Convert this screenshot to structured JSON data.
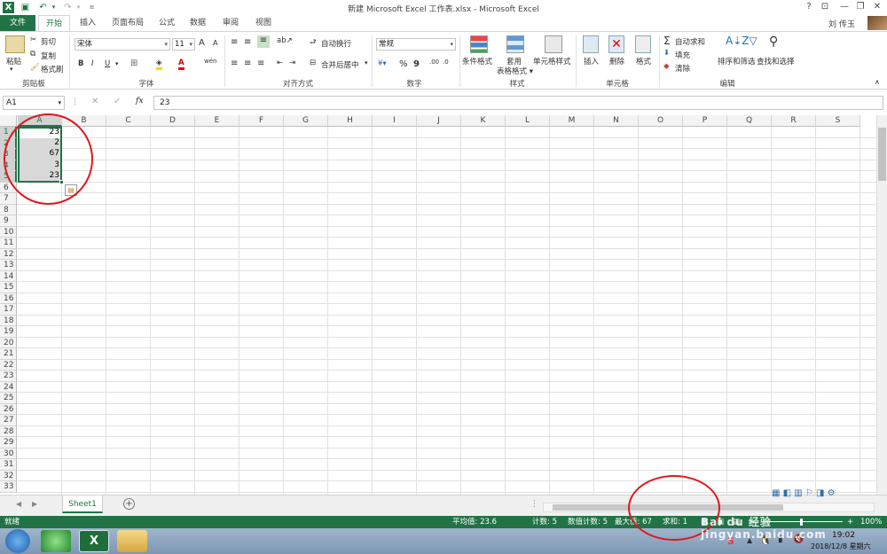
{
  "window": {
    "title": "新建 Microsoft Excel 工作表.xlsx - Microsoft Excel",
    "user": "刘 传玉",
    "help": "?",
    "minimize": "—",
    "restore": "❐",
    "close": "✕"
  },
  "tabs": [
    "文件",
    "开始",
    "插入",
    "页面布局",
    "公式",
    "数据",
    "审阅",
    "视图"
  ],
  "ribbon": {
    "clipboard": {
      "paste": "粘贴",
      "cut": "剪切",
      "copy": "复制",
      "format_painter": "格式刷",
      "label": "剪贴板"
    },
    "font": {
      "name": "宋体",
      "size": "11",
      "bold": "B",
      "italic": "I",
      "underline": "U",
      "grow": "A",
      "shrink": "A",
      "label": "字体"
    },
    "alignment": {
      "wrap": "自动换行",
      "merge": "合并后居中",
      "label": "对齐方式"
    },
    "number": {
      "format": "常规",
      "percent": "%",
      "comma": "9",
      "label": "数字"
    },
    "styles": {
      "conditional": "条件格式",
      "table_format": "套用\n表格格式",
      "cell_styles": "单元格样式",
      "label": "样式"
    },
    "cells": {
      "insert": "插入",
      "delete": "删除",
      "format": "格式",
      "label": "单元格"
    },
    "editing": {
      "autosum": "自动求和",
      "fill": "填充",
      "clear": "清除",
      "sort": "排序和筛选",
      "find": "查找和选择",
      "label": "编辑"
    }
  },
  "formula_bar": {
    "name_box": "A1",
    "value": "23",
    "fx": "fx"
  },
  "columns": [
    "A",
    "B",
    "C",
    "D",
    "E",
    "F",
    "G",
    "H",
    "I",
    "J",
    "K",
    "L",
    "M",
    "N",
    "O",
    "P",
    "Q",
    "R",
    "S"
  ],
  "rows": [
    "1",
    "2",
    "3",
    "4",
    "5",
    "6",
    "7",
    "8",
    "9",
    "10",
    "11",
    "12",
    "13",
    "14",
    "15",
    "16",
    "17",
    "18",
    "19",
    "20",
    "21",
    "22",
    "23",
    "24",
    "25",
    "26",
    "27",
    "28",
    "29",
    "30",
    "31",
    "32",
    "33"
  ],
  "cells": {
    "A1": "23",
    "A2": "2",
    "A3": "67",
    "A4": "3",
    "A5": "23"
  },
  "sheet_tabs": [
    "Sheet1"
  ],
  "status": {
    "mode": "就绪",
    "average": "平均值: 23.6",
    "count": "计数: 5",
    "numeric_count": "数值计数: 5",
    "max": "最大值: 67",
    "sum": "求和: 1",
    "zoom": "100%"
  },
  "taskbar": {
    "time": "19:02",
    "date": "2018/12/8 星期六"
  },
  "watermark": "Bai du 经验 jingyan.baidu.com",
  "colors": {
    "excel_green": "#217346",
    "annotation_red": "#e0161c"
  }
}
